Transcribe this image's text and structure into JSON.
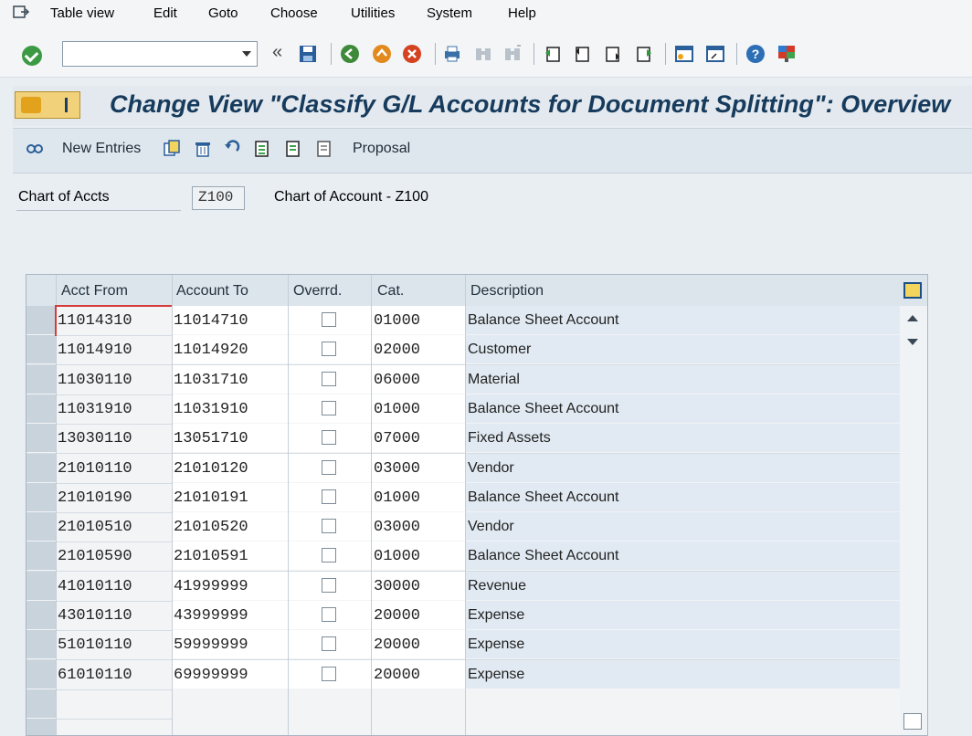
{
  "menu": {
    "items": [
      "Table view",
      "Edit",
      "Goto",
      "Choose",
      "Utilities",
      "System",
      "Help"
    ]
  },
  "toolbar": {
    "command_value": "",
    "icons": [
      "ok-check-icon",
      "save-icon",
      "back-icon",
      "exit-icon",
      "cancel-icon",
      "print-icon",
      "find-icon",
      "find-next-icon",
      "first-page-icon",
      "prev-page-icon",
      "next-page-icon",
      "last-page-icon",
      "create-session-icon",
      "shortcut-icon",
      "help-icon",
      "customize-layout-icon"
    ]
  },
  "title": "Change View \"Classify G/L Accounts for Document Splitting\": Overview",
  "app_toolbar": {
    "new_entries": "New Entries",
    "proposal": "Proposal"
  },
  "field": {
    "label": "Chart of Accts",
    "value": "Z100",
    "description": "Chart of Account - Z100"
  },
  "table": {
    "headers": [
      "Acct From",
      "Account To",
      "Overrd.",
      "Cat.",
      "Description"
    ],
    "rows": [
      {
        "from": "11014310",
        "to": "11014710",
        "overrd": false,
        "cat": "01000",
        "desc": "Balance Sheet Account"
      },
      {
        "from": "11014910",
        "to": "11014920",
        "overrd": false,
        "cat": "02000",
        "desc": "Customer"
      },
      {
        "from": "11030110",
        "to": "11031710",
        "overrd": false,
        "cat": "06000",
        "desc": "Material"
      },
      {
        "from": "11031910",
        "to": "11031910",
        "overrd": false,
        "cat": "01000",
        "desc": "Balance Sheet Account"
      },
      {
        "from": "13030110",
        "to": "13051710",
        "overrd": false,
        "cat": "07000",
        "desc": "Fixed Assets"
      },
      {
        "from": "21010110",
        "to": "21010120",
        "overrd": false,
        "cat": "03000",
        "desc": "Vendor"
      },
      {
        "from": "21010190",
        "to": "21010191",
        "overrd": false,
        "cat": "01000",
        "desc": "Balance Sheet Account"
      },
      {
        "from": "21010510",
        "to": "21010520",
        "overrd": false,
        "cat": "03000",
        "desc": "Vendor"
      },
      {
        "from": "21010590",
        "to": "21010591",
        "overrd": false,
        "cat": "01000",
        "desc": "Balance Sheet Account"
      },
      {
        "from": "41010110",
        "to": "41999999",
        "overrd": false,
        "cat": "30000",
        "desc": "Revenue"
      },
      {
        "from": "43010110",
        "to": "43999999",
        "overrd": false,
        "cat": "20000",
        "desc": "Expense"
      },
      {
        "from": "51010110",
        "to": "59999999",
        "overrd": false,
        "cat": "20000",
        "desc": "Expense"
      },
      {
        "from": "61010110",
        "to": "69999999",
        "overrd": false,
        "cat": "20000",
        "desc": "Expense"
      }
    ]
  }
}
